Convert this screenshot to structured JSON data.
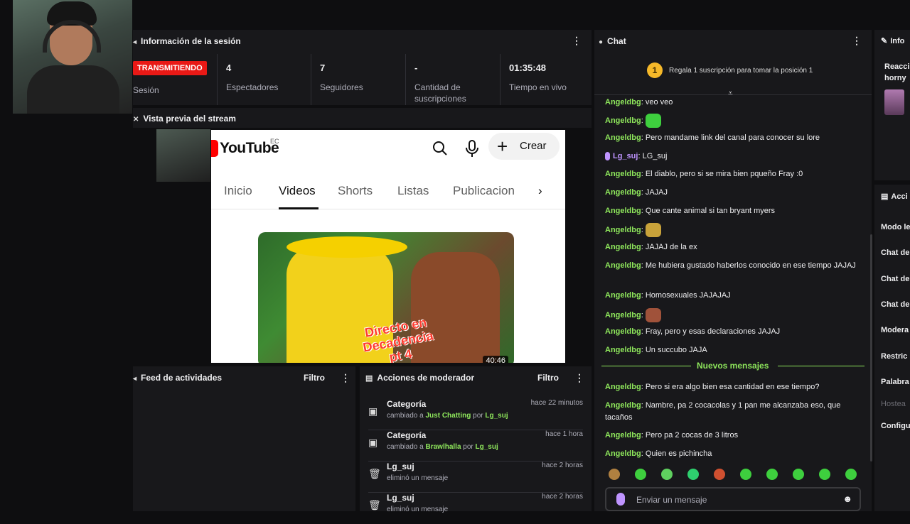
{
  "session": {
    "title": "Información de la sesión",
    "live_badge": "TRANSMITIENDO",
    "session_label": "Sesión",
    "stats": [
      {
        "value": "4",
        "label": "Espectadores"
      },
      {
        "value": "7",
        "label": "Seguidores"
      },
      {
        "value": "-",
        "label": "Cantidad de suscripciones"
      },
      {
        "value": "01:35:48",
        "label": "Tiempo en vivo"
      }
    ]
  },
  "preview": {
    "title": "Vista previa del stream",
    "youtube": {
      "logo": "YouTube",
      "country": "EC",
      "create": "Crear",
      "tabs": [
        "Inicio",
        "Videos",
        "Shorts",
        "Listas",
        "Publicacion"
      ],
      "video_title": "Directo en Decadencia",
      "video_subtitle": "pt 4",
      "duration": "40:46"
    }
  },
  "feed": {
    "title": "Feed de actividades",
    "filter": "Filtro"
  },
  "mod_actions": {
    "title": "Acciones de moderador",
    "filter": "Filtro",
    "items": [
      {
        "title": "Categoría",
        "prefix": "cambiado a ",
        "target": "Just Chatting",
        "mid": " por ",
        "user": "Lg_suj",
        "time": "hace 22 minutos"
      },
      {
        "title": "Categoría",
        "prefix": "cambiado a ",
        "target": "Brawlhalla",
        "mid": " por ",
        "user": "Lg_suj",
        "time": "hace 1 hora"
      },
      {
        "title": "Lg_suj",
        "prefix": "eliminó un mensaje",
        "target": "",
        "mid": "",
        "user": "",
        "time": "hace 2 horas"
      },
      {
        "title": "Lg_suj",
        "prefix": "eliminó un mensaje",
        "target": "",
        "mid": "",
        "user": "",
        "time": "hace 2 horas"
      }
    ]
  },
  "chat": {
    "title": "Chat",
    "sub_position": "1",
    "sub_text": "Regala 1 suscripción para tomar la posición 1",
    "new_messages": "Nuevos mensajes",
    "input_placeholder": "Enviar un mensaje",
    "messages": [
      {
        "user": "Angeldbg",
        "text": "veo veo",
        "emote": false
      },
      {
        "user": "Angeldbg",
        "text": "",
        "emote": true,
        "emote_color": "#3ecf3e"
      },
      {
        "user": "Angeldbg",
        "text": "Pero mandame link del canal para conocer su lore",
        "emote": false
      },
      {
        "user": "Lg_suj",
        "text": "LG_suj",
        "emote": false,
        "purple": true
      },
      {
        "user": "Angeldbg",
        "text": "El diablo, pero si se mira bien pqueño Fray :0",
        "emote": false
      },
      {
        "user": "Angeldbg",
        "text": "JAJAJ",
        "emote": false
      },
      {
        "user": "Angeldbg",
        "text": "Que cante animal si tan bryant myers",
        "emote": false
      },
      {
        "user": "Angeldbg",
        "text": "",
        "emote": true,
        "emote_color": "#c8a23a"
      },
      {
        "user": "Angeldbg",
        "text": "JAJAJ de la ex",
        "emote": false
      },
      {
        "user": "Angeldbg",
        "text": "Me hubiera gustado haberlos conocido en ese tiempo JAJAJ",
        "emote": false
      },
      {
        "user": "Angeldbg",
        "text": "Homosexuales JAJAJAJ",
        "emote": false
      },
      {
        "user": "Angeldbg",
        "text": "",
        "emote": true,
        "emote_color": "#a0523a"
      },
      {
        "user": "Angeldbg",
        "text": "Fray, pero y esas declaraciones JAJAJ",
        "emote": false
      },
      {
        "user": "Angeldbg",
        "text": "Un succubo JAJA",
        "emote": false
      },
      {
        "user": "Angeldbg",
        "text": "Pero si era algo bien esa cantidad en ese tiempo?",
        "emote": false
      },
      {
        "user": "Angeldbg",
        "text": "Nambre, pa 2 cocacolas y 1 pan me alcanzaba eso, que tacaños",
        "emote": false
      },
      {
        "user": "Angeldbg",
        "text": "Pero pa 2 cocas de 3 litros",
        "emote": false
      },
      {
        "user": "Angeldbg",
        "text": "Quien es pichincha",
        "emote": false
      }
    ],
    "emote_bar": [
      "#b08040",
      "#3ecf3e",
      "#5fd05f",
      "#2ecf6e",
      "#d05030",
      "#3ecf3e",
      "#3ecf3e",
      "#3ecf3e",
      "#3ecf3e",
      "#3ecf3e"
    ]
  },
  "right_panel": {
    "title": "Info",
    "reaction": "Reacci",
    "reaction2": "horny",
    "actions_title": "Acci",
    "items": [
      "Modo le",
      "Chat de",
      "Chat de",
      "Chat de",
      "Modera",
      "Restric",
      "Palabra",
      "Hostea",
      "Configu"
    ]
  },
  "colors": {
    "accent": "#8fe85c",
    "live": "#e91916",
    "purple": "#bf94ff"
  }
}
